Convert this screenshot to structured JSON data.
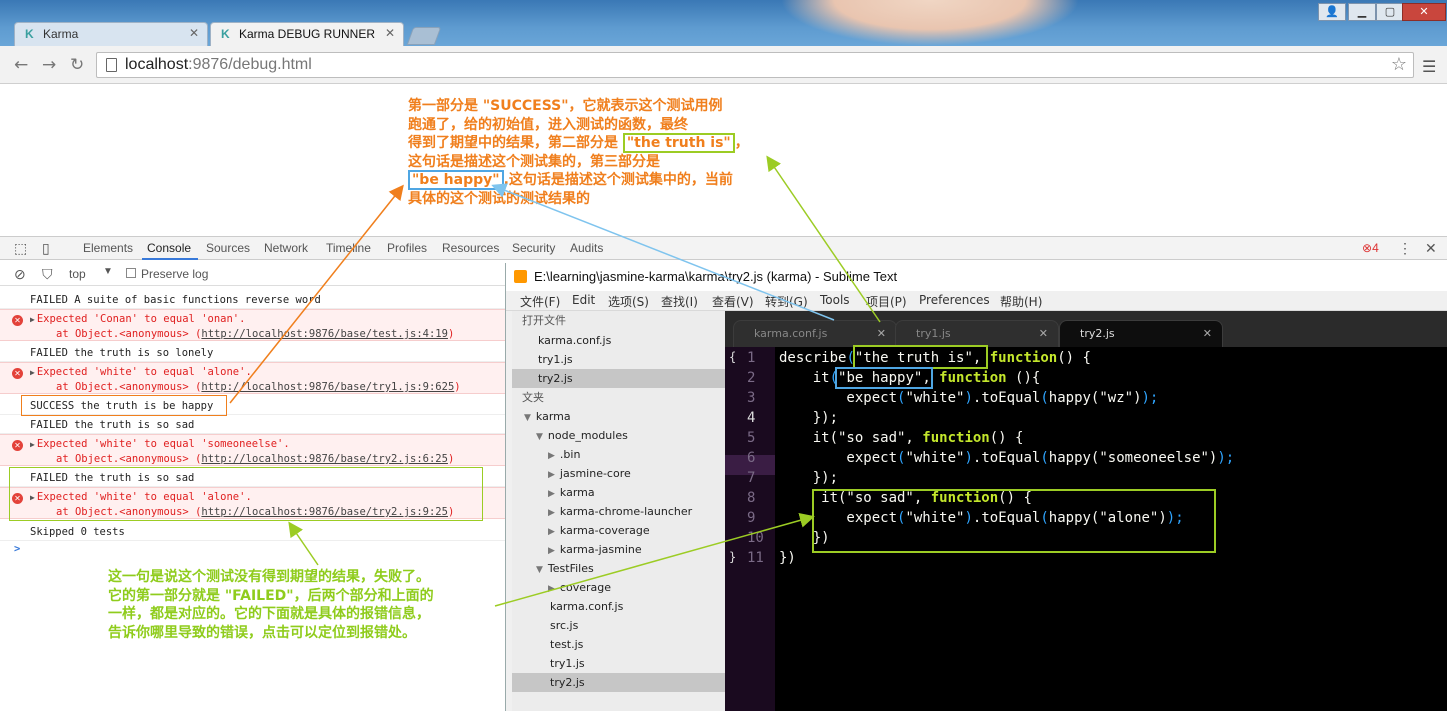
{
  "browser": {
    "tabs": [
      {
        "label": "Karma",
        "active": false
      },
      {
        "label": "Karma DEBUG RUNNER",
        "active": true
      }
    ],
    "url_host": "localhost",
    "url_rest": ":9876/debug.html"
  },
  "annotations": {
    "top_1": "第一部分是 \"SUCCESS\"，它就表示这个测试用例",
    "top_2": "跑通了，给的初始值，进入测试的函数，最终",
    "top_3a": "得到了期望中的结果，第二部分是 ",
    "top_3_hl": "\"the truth is\"",
    "top_3b": "，",
    "top_4": "这句话是描述这个测试集的，第三部分是",
    "top_5_hl": "\"be happy\"",
    "top_5b": ",这句话是描述这个测试集中的，当前",
    "top_6": "具体的这个测试的测试结果的",
    "bottom_1": "这一句是说这个测试没有得到期望的结果，失败了。",
    "bottom_2": "它的第一部分就是 \"FAILED\"，后两个部分和上面的",
    "bottom_3": "一样，都是对应的。它的下面就是具体的报错信息，",
    "bottom_4": "告诉你哪里导致的错误，点击可以定位到报错处。"
  },
  "devtools": {
    "tabs": [
      "Elements",
      "Console",
      "Sources",
      "Network",
      "Timeline",
      "Profiles",
      "Resources",
      "Security",
      "Audits"
    ],
    "selected_tab": "Console",
    "error_count": "4",
    "filter_context": "top",
    "preserve_log": "Preserve log",
    "console_lines": [
      {
        "type": "log",
        "text": "FAILED A suite of basic functions reverse word"
      },
      {
        "type": "error",
        "text": "Expected 'Conan' to equal 'onan'.",
        "at": "at Object.<anonymous> (",
        "link": "http://localhost:9876/base/test.js:4:19",
        "close": ")"
      },
      {
        "type": "log",
        "text": "FAILED the truth is so lonely"
      },
      {
        "type": "error",
        "text": "Expected 'white' to equal 'alone'.",
        "at": "at Object.<anonymous> (",
        "link": "http://localhost:9876/base/try1.js:9:625",
        "close": ")"
      },
      {
        "type": "log",
        "text": "SUCCESS the truth is be happy"
      },
      {
        "type": "log",
        "text": "FAILED the truth is so sad"
      },
      {
        "type": "error",
        "text": "Expected 'white' to equal 'someoneelse'.",
        "at": "at Object.<anonymous> (",
        "link": "http://localhost:9876/base/try2.js:6:25",
        "close": ")"
      },
      {
        "type": "log",
        "text": "FAILED the truth is so sad"
      },
      {
        "type": "error",
        "text": "Expected 'white' to equal 'alone'.",
        "at": "at Object.<anonymous> (",
        "link": "http://localhost:9876/base/try2.js:9:25",
        "close": ")"
      },
      {
        "type": "log",
        "text": "Skipped 0 tests"
      }
    ],
    "prompt": ">"
  },
  "sublime": {
    "title": "E:\\learning\\jasmine-karma\\karma\\try2.js (karma) - Sublime Text",
    "menu": [
      "文件(F)",
      "Edit",
      "选项(S)",
      "查找(I)",
      "查看(V)",
      "转到(G)",
      "Tools",
      "项目(P)",
      "Preferences",
      "帮助(H)"
    ],
    "sidebar": {
      "open_files_header": "打开文件",
      "open_files": [
        "karma.conf.js",
        "try1.js",
        "try2.js"
      ],
      "folders_header": "文夹",
      "tree": [
        {
          "label": "karma",
          "depth": 0,
          "arrow": "▼"
        },
        {
          "label": "node_modules",
          "depth": 1,
          "arrow": "▼"
        },
        {
          "label": ".bin",
          "depth": 2,
          "arrow": "▶"
        },
        {
          "label": "jasmine-core",
          "depth": 2,
          "arrow": "▶"
        },
        {
          "label": "karma",
          "depth": 2,
          "arrow": "▶"
        },
        {
          "label": "karma-chrome-launcher",
          "depth": 2,
          "arrow": "▶"
        },
        {
          "label": "karma-coverage",
          "depth": 2,
          "arrow": "▶"
        },
        {
          "label": "karma-jasmine",
          "depth": 2,
          "arrow": "▶"
        },
        {
          "label": "TestFiles",
          "depth": 1,
          "arrow": "▼"
        },
        {
          "label": "coverage",
          "depth": 2,
          "arrow": "▶"
        },
        {
          "label": "karma.conf.js",
          "depth": 2,
          "arrow": ""
        },
        {
          "label": "src.js",
          "depth": 2,
          "arrow": ""
        },
        {
          "label": "test.js",
          "depth": 2,
          "arrow": ""
        },
        {
          "label": "try1.js",
          "depth": 2,
          "arrow": ""
        },
        {
          "label": "try2.js",
          "depth": 2,
          "arrow": ""
        }
      ]
    },
    "tabs": [
      "karma.conf.js",
      "try1.js",
      "try2.js"
    ],
    "active_tab": "try2.js",
    "line_numbers": [
      "1",
      "2",
      "3",
      "4",
      "5",
      "6",
      "7",
      "8",
      "9",
      "10",
      "11"
    ],
    "code": {
      "l1_a": "describe",
      "l1_b": "\"the truth is\"",
      "l1_c": ", ",
      "l1_d": "function",
      "l1_e": "() {",
      "l2_a": "    it",
      "l2_b": "\"be happy\"",
      "l2_c": ", ",
      "l2_d": "function",
      "l2_e": " (){",
      "l3_a": "        expect",
      "l3_b": "(",
      "l3_c": "\"white\"",
      "l3_d": ")",
      "l3_e": ".toEqual",
      "l3_f": "(",
      "l3_g": "happy(\"wz\")",
      "l3_h": ");",
      "l4": "    });",
      "l5_a": "    it(\"so sad\", ",
      "l5_b": "function",
      "l5_c": "() {",
      "l6_g": "happy(\"someoneelse\")",
      "l7": "    });",
      "l8_a": "     it(\"so sad\", ",
      "l9_g": "happy(\"alone\")",
      "l10": "    })",
      "l11": "})"
    }
  }
}
